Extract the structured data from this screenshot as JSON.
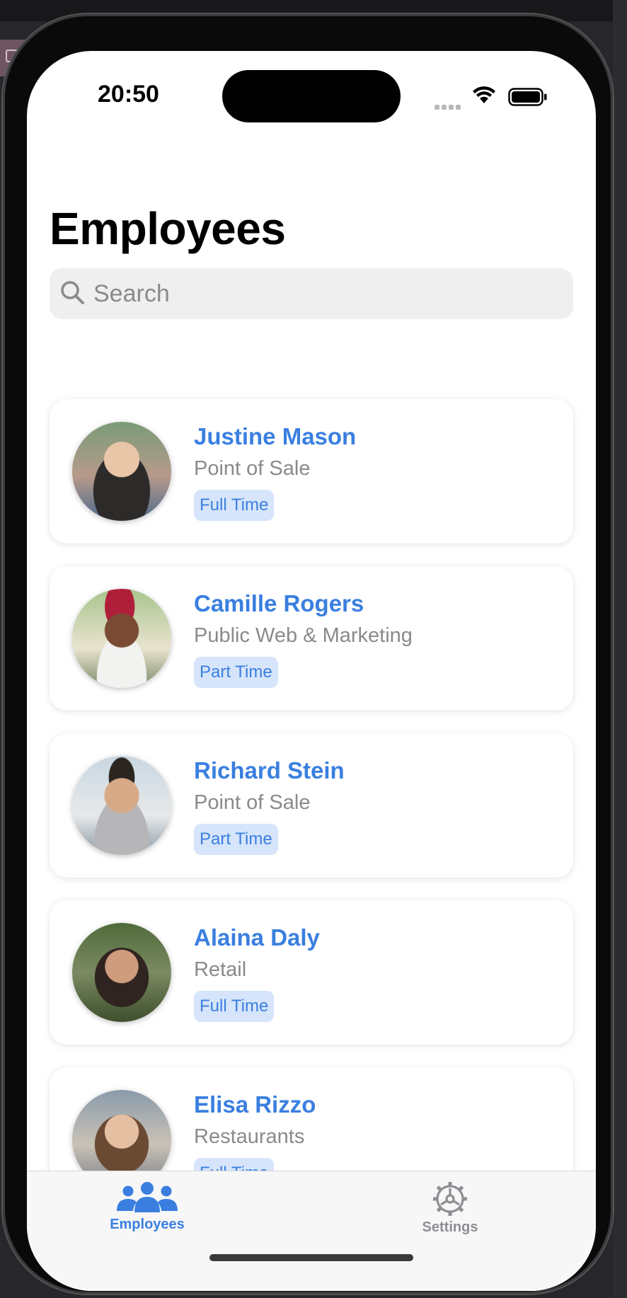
{
  "status_bar": {
    "time": "20:50"
  },
  "page_title": "Employees",
  "search": {
    "placeholder": "Search"
  },
  "employees": [
    {
      "name": "Justine Mason",
      "department": "Point of Sale",
      "employment": "Full Time"
    },
    {
      "name": "Camille Rogers",
      "department": "Public Web & Marketing",
      "employment": "Part Time"
    },
    {
      "name": "Richard Stein",
      "department": "Point of Sale",
      "employment": "Part Time"
    },
    {
      "name": "Alaina Daly",
      "department": "Retail",
      "employment": "Full Time"
    },
    {
      "name": "Elisa Rizzo",
      "department": "Restaurants",
      "employment": "Full Time"
    }
  ],
  "tab_bar": {
    "tabs": [
      {
        "label": "Employees",
        "icon": "people-icon",
        "selected": true
      },
      {
        "label": "Settings",
        "icon": "gear-icon",
        "selected": false
      }
    ]
  },
  "colors": {
    "accent": "#3a7fe0",
    "badge_bg": "#d6e5fb",
    "secondary_text": "#8a8a8e",
    "inactive_tab": "#8e8e93"
  }
}
